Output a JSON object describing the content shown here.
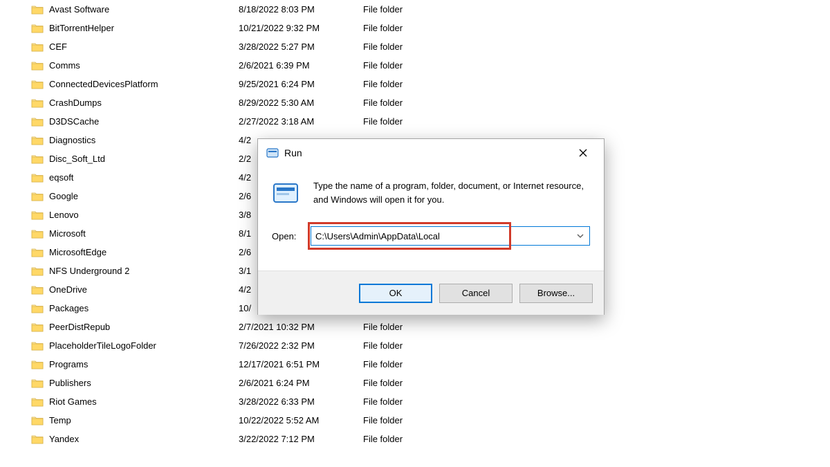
{
  "explorer": {
    "rows": [
      {
        "name": "Avast Software",
        "date": "8/18/2022 8:03 PM",
        "type": "File folder"
      },
      {
        "name": "BitTorrentHelper",
        "date": "10/21/2022 9:32 PM",
        "type": "File folder"
      },
      {
        "name": "CEF",
        "date": "3/28/2022 5:27 PM",
        "type": "File folder"
      },
      {
        "name": "Comms",
        "date": "2/6/2021 6:39 PM",
        "type": "File folder"
      },
      {
        "name": "ConnectedDevicesPlatform",
        "date": "9/25/2021 6:24 PM",
        "type": "File folder"
      },
      {
        "name": "CrashDumps",
        "date": "8/29/2022 5:30 AM",
        "type": "File folder"
      },
      {
        "name": "D3DSCache",
        "date": "2/27/2022 3:18 AM",
        "type": "File folder"
      },
      {
        "name": "Diagnostics",
        "date": "4/2",
        "type": ""
      },
      {
        "name": "Disc_Soft_Ltd",
        "date": "2/2",
        "type": ""
      },
      {
        "name": "eqsoft",
        "date": "4/2",
        "type": ""
      },
      {
        "name": "Google",
        "date": "2/6",
        "type": ""
      },
      {
        "name": "Lenovo",
        "date": "3/8",
        "type": ""
      },
      {
        "name": "Microsoft",
        "date": "8/1",
        "type": ""
      },
      {
        "name": "MicrosoftEdge",
        "date": "2/6",
        "type": ""
      },
      {
        "name": "NFS Underground 2",
        "date": "3/1",
        "type": ""
      },
      {
        "name": "OneDrive",
        "date": "4/2",
        "type": ""
      },
      {
        "name": "Packages",
        "date": "10/",
        "type": ""
      },
      {
        "name": "PeerDistRepub",
        "date": "2/7/2021 10:32 PM",
        "type": "File folder"
      },
      {
        "name": "PlaceholderTileLogoFolder",
        "date": "7/26/2022 2:32 PM",
        "type": "File folder"
      },
      {
        "name": "Programs",
        "date": "12/17/2021 6:51 PM",
        "type": "File folder"
      },
      {
        "name": "Publishers",
        "date": "2/6/2021 6:24 PM",
        "type": "File folder"
      },
      {
        "name": "Riot Games",
        "date": "3/28/2022 6:33 PM",
        "type": "File folder"
      },
      {
        "name": "Temp",
        "date": "10/22/2022 5:52 AM",
        "type": "File folder"
      },
      {
        "name": "Yandex",
        "date": "3/22/2022 7:12 PM",
        "type": "File folder"
      }
    ]
  },
  "run": {
    "title": "Run",
    "instruction": "Type the name of a program, folder, document, or Internet resource, and Windows will open it for you.",
    "open_label": "Open:",
    "input_value": "C:\\Users\\Admin\\AppData\\Local",
    "ok": "OK",
    "cancel": "Cancel",
    "browse": "Browse..."
  }
}
